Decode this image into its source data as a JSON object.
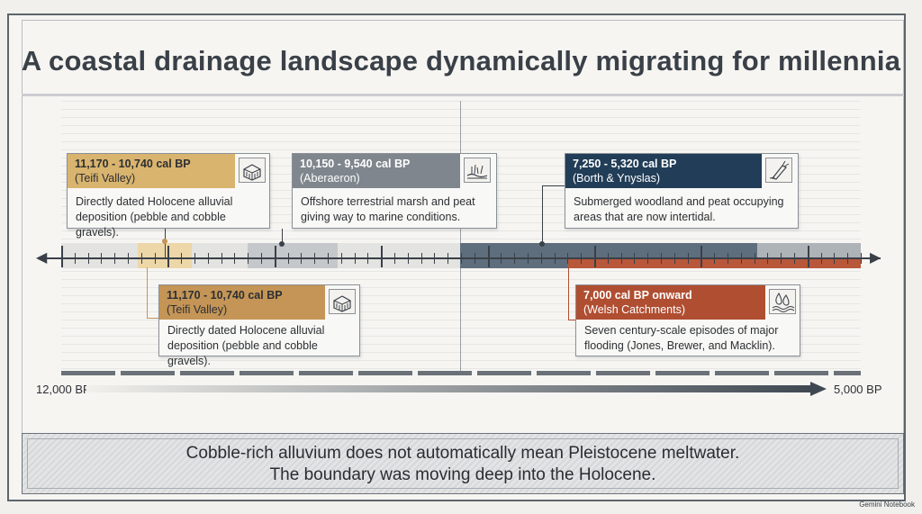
{
  "title": "A coastal drainage landscape dynamically migrating for millennia",
  "cards": [
    {
      "id": "teifi-top",
      "range": "11,170 - 10,740 cal BP",
      "place": "(Teifi Valley)",
      "body": [
        "Directly dated Holocene alluvial",
        "deposition (pebble and cobble gravels)."
      ],
      "icon": "gravel-icon",
      "color": "#d9b46e"
    },
    {
      "id": "aberaeron",
      "range": "10,150 - 9,540 cal BP",
      "place": "(Aberaeron)",
      "body": [
        "Offshore terrestrial marsh and peat",
        "giving way to marine conditions."
      ],
      "icon": "marsh-icon",
      "color": "#7f868d"
    },
    {
      "id": "borth",
      "range": "7,250 - 5,320 cal BP",
      "place": "(Borth & Ynyslas)",
      "body": [
        "Submerged woodland and peat occupying",
        "areas that are now intertidal."
      ],
      "icon": "tree-stump-icon",
      "color": "#213d57"
    },
    {
      "id": "teifi-bottom",
      "range": "11,170 - 10,740 cal BP",
      "place": "(Teifi Valley)",
      "body": [
        "Directly dated Holocene alluvial",
        "deposition (pebble and cobble gravels)."
      ],
      "icon": "gravel-icon",
      "color": "#c49556"
    },
    {
      "id": "welsh",
      "range": "7,000 cal BP onward",
      "place": "(Welsh Catchments)",
      "body": [
        "Seven century-scale episodes of major",
        "flooding (Jones, Brewer, and Macklin)."
      ],
      "icon": "flood-water-icon",
      "color": "#b04e32"
    }
  ],
  "scale": {
    "start": "12,000 BP",
    "end": "5,000 BP"
  },
  "summary": [
    "Cobble-rich alluvium does not automatically mean Pleistocene meltwater.",
    "The boundary was moving deep into the Holocene."
  ],
  "brand": "Gemini Notebook"
}
